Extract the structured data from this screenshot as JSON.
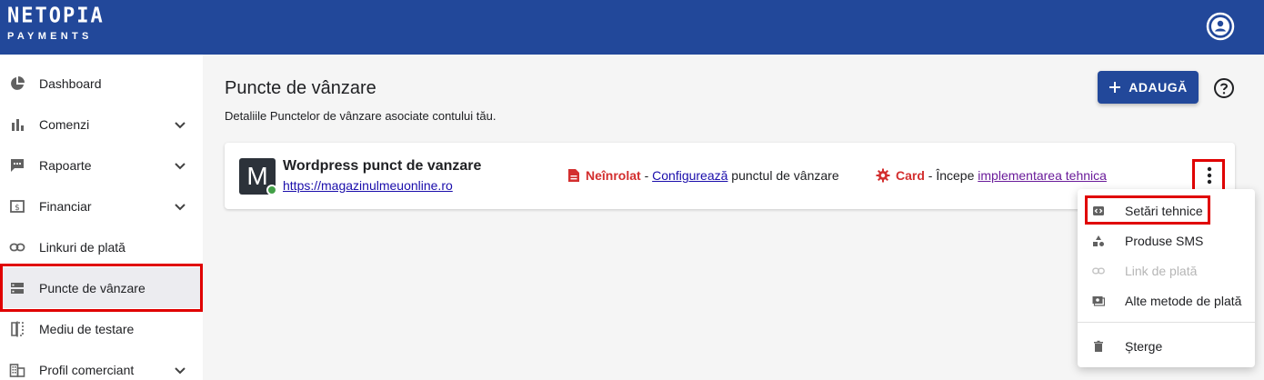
{
  "brand": {
    "line1": "NETOPIA",
    "line2": "PAYMENTS"
  },
  "header": {
    "account_icon": "account-circle-icon"
  },
  "sidebar": {
    "items": [
      {
        "label": "Dashboard",
        "icon": "pie-chart-icon"
      },
      {
        "label": "Comenzi",
        "icon": "bar-chart-icon"
      },
      {
        "label": "Rapoarte",
        "icon": "comment-icon"
      },
      {
        "label": "Financiar",
        "icon": "money-icon"
      },
      {
        "label": "Linkuri de plată",
        "icon": "link-icon"
      },
      {
        "label": "Puncte de vânzare",
        "icon": "storage-icon"
      },
      {
        "label": "Mediu de testare",
        "icon": "compare-icon"
      },
      {
        "label": "Profil comerciant",
        "icon": "business-icon"
      }
    ]
  },
  "main": {
    "title": "Puncte de vânzare",
    "subtitle": "Detaliile Punctelor de vânzare asociate contului tău.",
    "add_button": "ADAUGĂ"
  },
  "pos": {
    "avatar_letter": "M",
    "name": "Wordpress punct de vanzare",
    "url": "https://magazinulmeuonline.ro",
    "enroll_status": "Neînrolat",
    "enroll_sep": " - ",
    "enroll_link": "Configurează",
    "enroll_suffix": " punctul de vânzare",
    "card_label": "Card",
    "card_sep": " - Începe ",
    "card_link": "implementarea tehnica"
  },
  "menu": {
    "items": [
      {
        "label": "Setări tehnice",
        "icon": "developer-board-icon"
      },
      {
        "label": "Produse SMS",
        "icon": "category-icon"
      },
      {
        "label": "Link de plată",
        "icon": "link-icon"
      },
      {
        "label": "Alte metode de plată",
        "icon": "payment-methods-icon"
      },
      {
        "label": "Șterge",
        "icon": "delete-icon"
      }
    ]
  },
  "colors": {
    "brand": "#22489a",
    "alert_red": "#d32f2f",
    "online": "#43a047",
    "highlight": "#e00000"
  }
}
